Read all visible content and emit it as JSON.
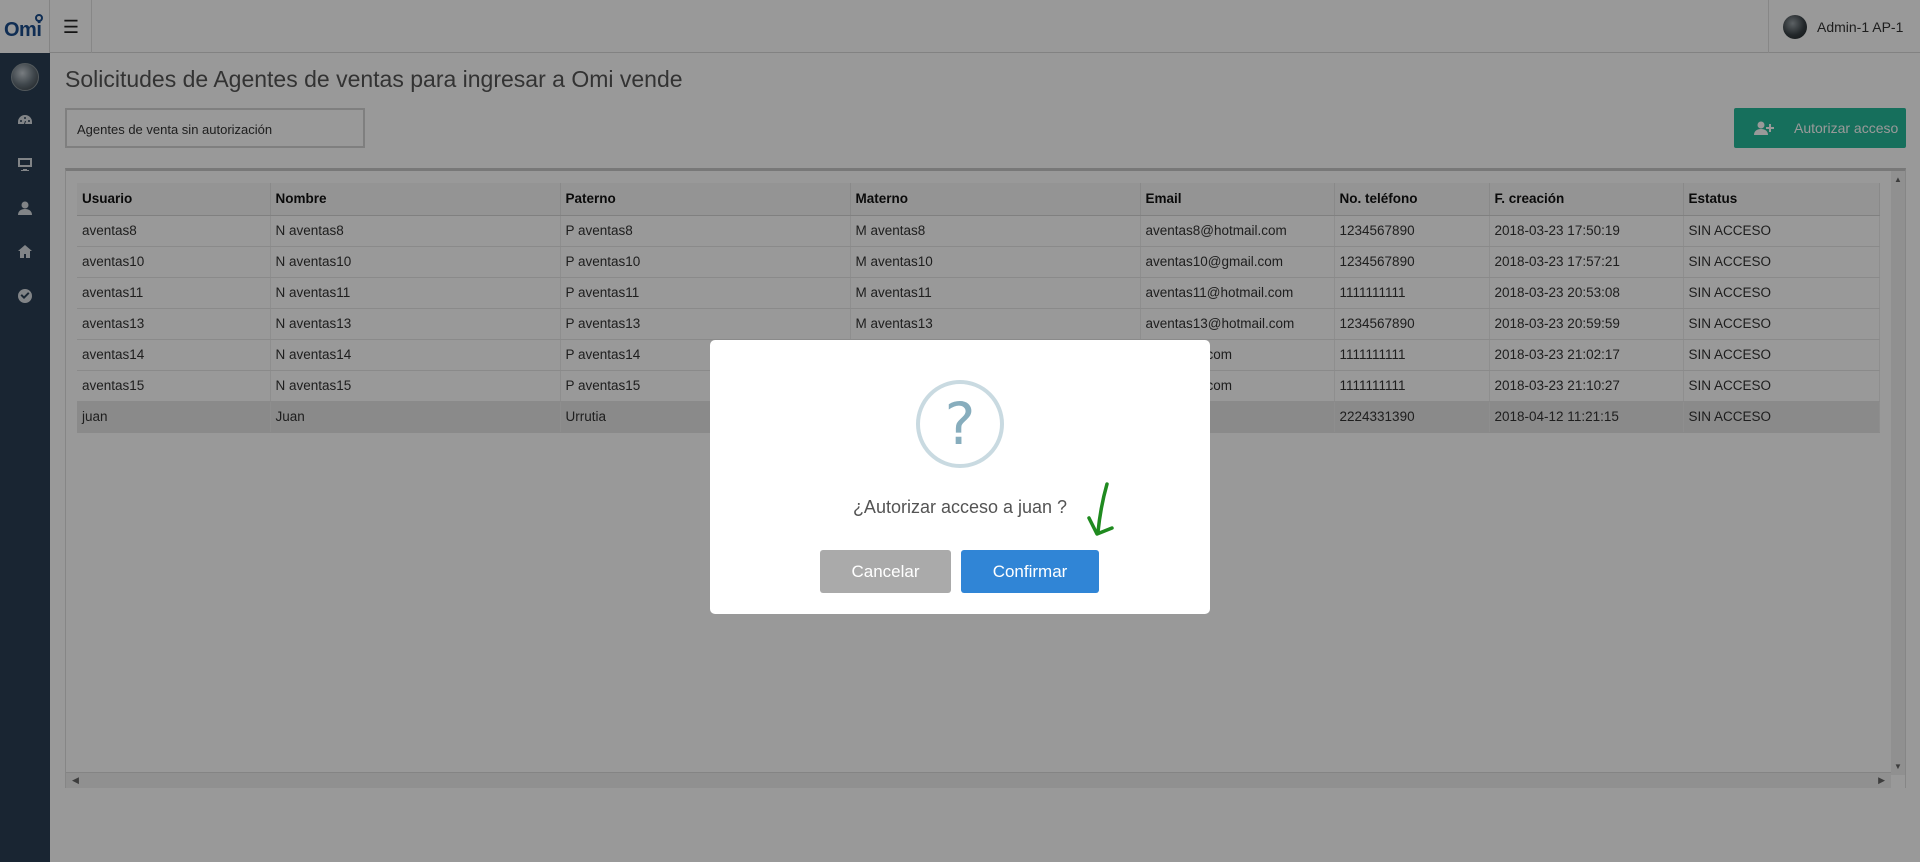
{
  "app": {
    "logo": "Omi",
    "user_name": "Admin-1 AP-1"
  },
  "sidebar": {
    "items": [
      {
        "icon": "dashboard-icon"
      },
      {
        "icon": "monitor-icon"
      },
      {
        "icon": "user-icon"
      },
      {
        "icon": "home-icon"
      },
      {
        "icon": "check-circle-icon"
      }
    ]
  },
  "page": {
    "title": "Solicitudes de Agentes de ventas para ingresar a Omi vende",
    "filter_value": "Agentes de venta sin autorización",
    "authorize_button": "Autorizar acceso"
  },
  "table": {
    "columns": [
      "Usuario",
      "Nombre",
      "Paterno",
      "Materno",
      "Email",
      "No. teléfono",
      "F. creación",
      "Estatus"
    ],
    "rows": [
      [
        "aventas8",
        "N aventas8",
        "P aventas8",
        "M aventas8",
        "aventas8@hotmail.com",
        "1234567890",
        "2018-03-23 17:50:19",
        "SIN ACCESO"
      ],
      [
        "aventas10",
        "N aventas10",
        "P aventas10",
        "M aventas10",
        "aventas10@gmail.com",
        "1234567890",
        "2018-03-23 17:57:21",
        "SIN ACCESO"
      ],
      [
        "aventas11",
        "N aventas11",
        "P aventas11",
        "M aventas11",
        "aventas11@hotmail.com",
        "1111111111",
        "2018-03-23 20:53:08",
        "SIN ACCESO"
      ],
      [
        "aventas13",
        "N aventas13",
        "P aventas13",
        "M aventas13",
        "aventas13@hotmail.com",
        "1234567890",
        "2018-03-23 20:59:59",
        "SIN ACCESO"
      ],
      [
        "aventas14",
        "N aventas14",
        "P aventas14",
        "",
        "@hotmail.com",
        "1111111111",
        "2018-03-23 21:02:17",
        "SIN ACCESO"
      ],
      [
        "aventas15",
        "N aventas15",
        "P aventas15",
        "",
        "@hotmail.com",
        "1111111111",
        "2018-03-23 21:10:27",
        "SIN ACCESO"
      ],
      [
        "juan",
        "Juan",
        "Urrutia",
        "",
        "nail.com",
        "2224331390",
        "2018-04-12 11:21:15",
        "SIN ACCESO"
      ]
    ],
    "selected_row": 6
  },
  "modal": {
    "icon": "?",
    "message": "¿Autorizar acceso a juan ?",
    "cancel_label": "Cancelar",
    "confirm_label": "Confirmar"
  },
  "colors": {
    "sidebar": "#2a3f54",
    "success": "#26b99a",
    "confirm": "#3085d6",
    "cancel": "#aaaaaa",
    "annotation": "#1f8a1f"
  }
}
